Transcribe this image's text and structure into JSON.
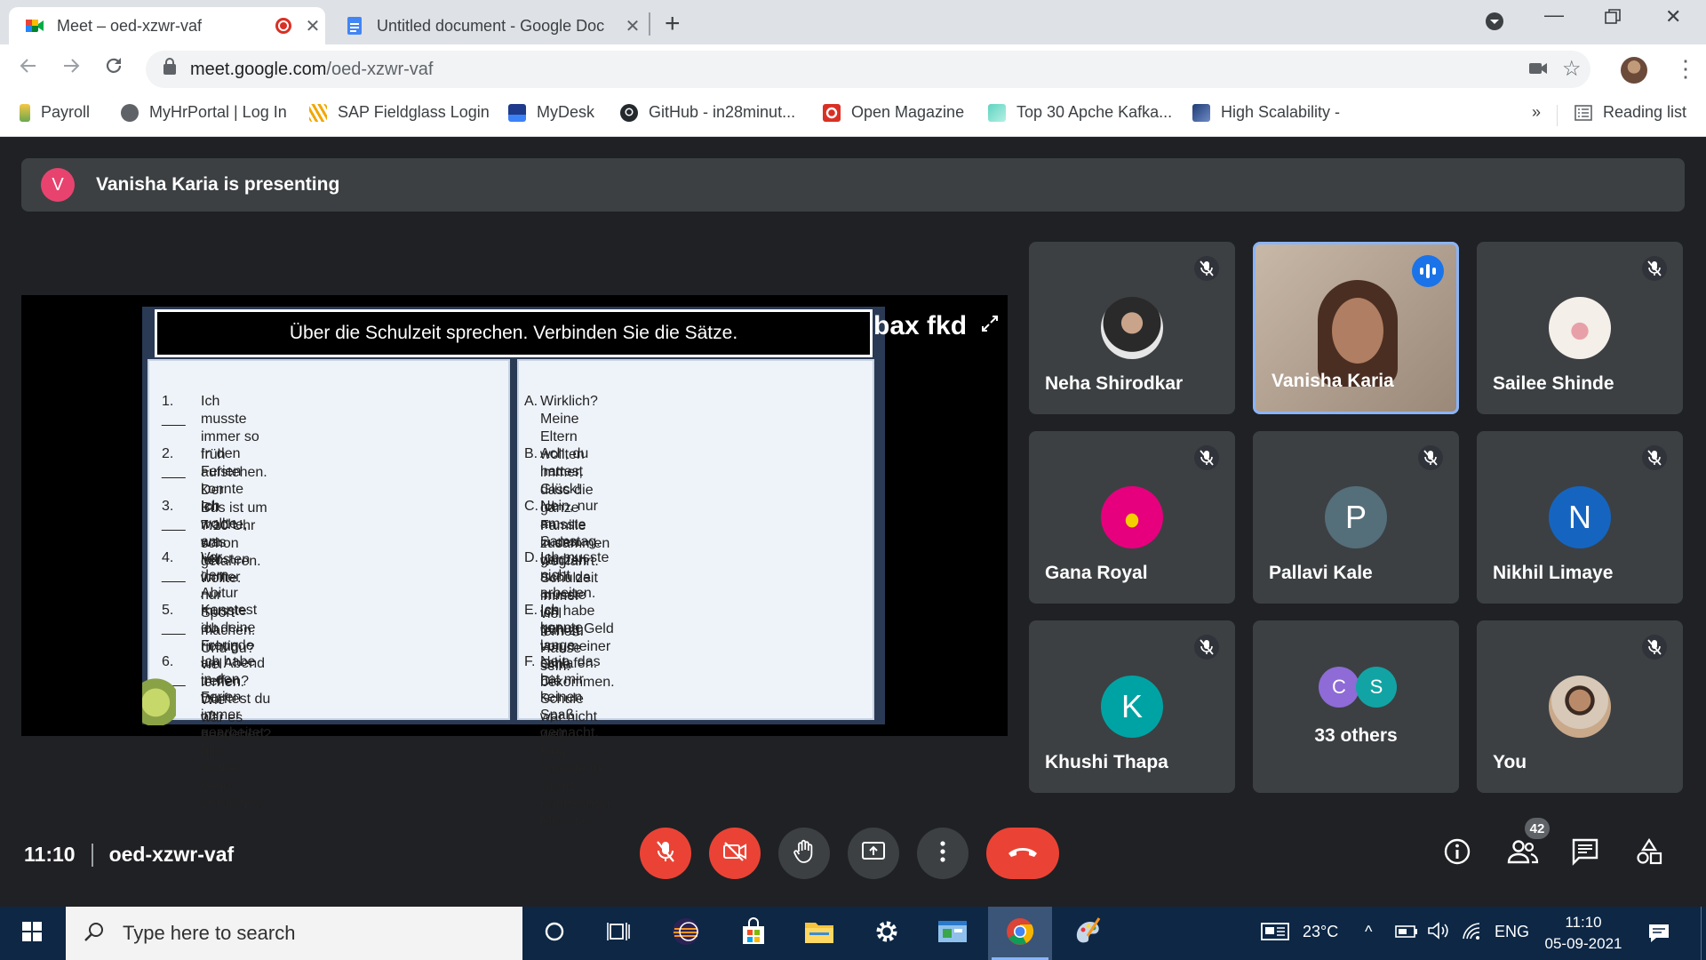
{
  "browser": {
    "tabs": [
      {
        "title": "Meet – oed-xzwr-vaf",
        "active": true,
        "icon": "google-meet-icon",
        "recording": true
      },
      {
        "title": "Untitled document - Google Doc",
        "active": false,
        "icon": "google-docs-icon"
      }
    ],
    "url_host": "meet.google.com",
    "url_path": "/oed-xzwr-vaf",
    "bookmarks": [
      {
        "label": "Payroll",
        "icon": "payroll-icon"
      },
      {
        "label": "MyHrPortal | Log In",
        "icon": "globe-icon"
      },
      {
        "label": "SAP Fieldglass Login",
        "icon": "fieldglass-icon"
      },
      {
        "label": "MyDesk",
        "icon": "mydesk-icon"
      },
      {
        "label": "GitHub - in28minut...",
        "icon": "github-icon"
      },
      {
        "label": "Open Magazine",
        "icon": "open-magazine-icon"
      },
      {
        "label": "Top 30 Apche Kafka...",
        "icon": "kafka-icon"
      },
      {
        "label": "High Scalability -",
        "icon": "high-scalability-icon"
      }
    ],
    "overflow_label": "»",
    "reading_list": "Reading list"
  },
  "meet": {
    "presenter_initial": "V",
    "presenting_text": "Vanisha Karia is presenting",
    "caption": "bax fkd",
    "slide": {
      "title": "Über die Schulzeit sprechen. Verbinden Sie die Sätze.",
      "left": [
        {
          "num": "1. ___",
          "l1": "Ich musste immer so früh aufstehen. Der",
          "l2": "Bus ist um 7:10 Uhr schon gefahren."
        },
        {
          "num": "2. ___",
          "l1": "In den Ferien konnte ich mache, was ich",
          "l2": "wollte."
        },
        {
          "num": "3. ___",
          "l1": "Ich wollte am liebsten immer nur Sport",
          "l2": "machen. Und du?"
        },
        {
          "num": "4. ___",
          "l1": "Vor dem Abitur musste ich richtig viel",
          "l2": "lernen. Wie war es bei dir?"
        },
        {
          "num": "5. ___",
          "l1": "Konntest du deine Freunde am Abend",
          "l2": "treffen? Durftest du oft ausgehen?"
        },
        {
          "num": "6. ___",
          "l1": "Ich habe in den Ferien immer gearbeitet. Ich",
          "l2": "wollte Geld verdienen."
        }
      ],
      "right": [
        {
          "num": "A.",
          "l1": "Wirklich? Meine Eltern wollten immer, dass die",
          "l2": "ganze Familie zusammen wegfährt."
        },
        {
          "num": "B.",
          "l1": "Ach, du hattest Glück! Ich musste in den ganzen",
          "l2": "Schulzeit immer viel lernen."
        },
        {
          "num": "C.",
          "l1": "Nein, nur am Samstag. Und auch da musste ich",
          "l2": "früh zu Hause sein."
        },
        {
          "num": "D.",
          "l1": "Ich musste nicht arbeiten. Ich habe genug Geld",
          "l2": "von meiner Oma bekommen."
        },
        {
          "num": "E.",
          "l1": "Ich konnte lange schlafen. Die Schule war nicht",
          "l2": "weit weg."
        },
        {
          "num": "F.",
          "l1": "Nein, das hat mir keinen Spaß gemacht. Ich",
          "l2": "musste in Sport mitmachen. Musste!"
        }
      ]
    },
    "participants": [
      {
        "name": "Neha Shirodkar",
        "type": "photo",
        "muted": true
      },
      {
        "name": "Vanisha Karia",
        "type": "video",
        "speaking": true
      },
      {
        "name": "Sailee Shinde",
        "type": "photo",
        "muted": true
      },
      {
        "name": "Gana Royal",
        "type": "photo",
        "muted": true
      },
      {
        "name": "Pallavi Kale",
        "type": "letter",
        "letter": "P",
        "color": "#546e7a",
        "muted": true
      },
      {
        "name": "Nikhil Limaye",
        "type": "letter",
        "letter": "N",
        "color": "#1565c0",
        "muted": true
      },
      {
        "name": "Khushi Thapa",
        "type": "letter",
        "letter": "K",
        "color": "#00a3a3",
        "muted": true
      },
      {
        "name": "33 others",
        "type": "others",
        "letters": [
          "C",
          "S"
        ],
        "colors": [
          "#8e6bd6",
          "#12a4a4"
        ]
      },
      {
        "name": "You",
        "type": "photo",
        "muted": true
      }
    ],
    "time": "11:10",
    "meeting_code": "oed-xzwr-vaf",
    "participant_count": "42"
  },
  "taskbar": {
    "search_placeholder": "Type here to search",
    "weather": "23°C",
    "language": "ENG",
    "time": "11:10",
    "date": "05-09-2021"
  },
  "colors": {
    "meet_bg": "#202124",
    "tile_bg": "#3c4043",
    "danger": "#ea4335",
    "speaking_blue": "#1a73e8",
    "taskbar_bg": "#0d2745"
  }
}
